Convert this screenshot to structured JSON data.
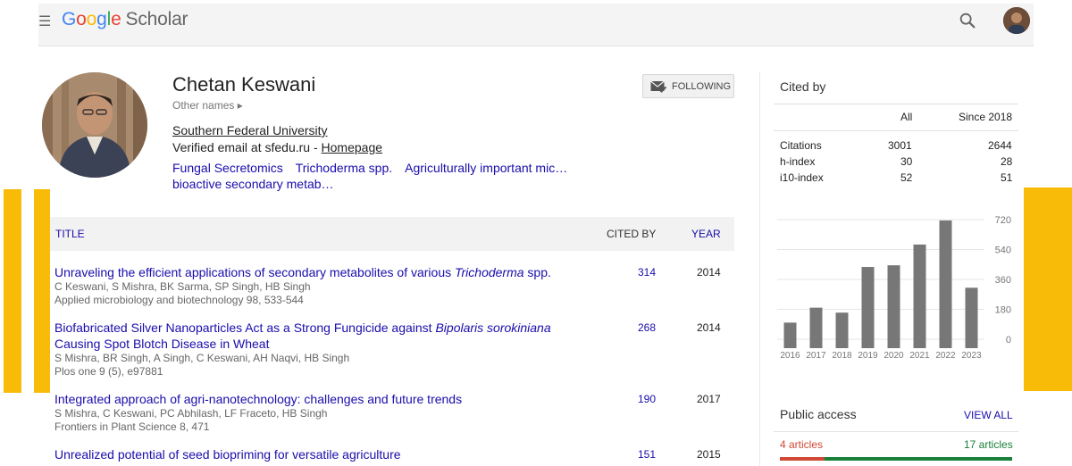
{
  "app": {
    "logo_google": [
      "G",
      "o",
      "o",
      "g",
      "l",
      "e"
    ],
    "logo_scholar": "Scholar"
  },
  "profile": {
    "name": "Chetan Keswani",
    "other_names": "Other names",
    "affiliation": "Southern Federal University",
    "email_prefix": "Verified email at sfedu.ru - ",
    "homepage": "Homepage",
    "interests": [
      "Fungal Secretomics",
      "Trichoderma spp.",
      "Agriculturally important mic…",
      "bioactive secondary metab…"
    ]
  },
  "follow": {
    "label": "FOLLOWING"
  },
  "table": {
    "col_title": "TITLE",
    "col_cited": "CITED BY",
    "col_year": "YEAR"
  },
  "articles": [
    {
      "title_a": "Unraveling the efficient applications of secondary metabolites of various ",
      "title_b": "Trichoderma",
      "title_c": " spp.",
      "authors": "C Keswani, S Mishra, BK Sarma, SP Singh, HB Singh",
      "venue": "Applied microbiology and biotechnology 98, 533-544",
      "cites": "314",
      "year": "2014"
    },
    {
      "title_a": "Biofabricated Silver Nanoparticles Act as a Strong Fungicide against ",
      "title_b": "Bipolaris sorokiniana",
      "title_c": " Causing Spot Blotch Disease in Wheat",
      "authors": "S Mishra, BR Singh, A Singh, C Keswani, AH Naqvi, HB Singh",
      "venue": "Plos one 9 (5), e97881",
      "cites": "268",
      "year": "2014"
    },
    {
      "title_a": "Integrated approach of agri-nanotechnology: challenges and future trends",
      "title_b": "",
      "title_c": "",
      "authors": "S Mishra, C Keswani, PC Abhilash, LF Fraceto, HB Singh",
      "venue": "Frontiers in Plant Science 8, 471",
      "cites": "190",
      "year": "2017"
    },
    {
      "title_a": "Unrealized potential of seed biopriming for versatile agriculture",
      "title_b": "",
      "title_c": "",
      "authors": "",
      "venue": "",
      "cites": "151",
      "year": "2015"
    }
  ],
  "cited_by": {
    "title": "Cited by",
    "col_all": "All",
    "col_since": "Since 2018",
    "rows": [
      {
        "label": "Citations",
        "all": "3001",
        "since": "2644"
      },
      {
        "label": "h-index",
        "all": "30",
        "since": "28"
      },
      {
        "label": "i10-index",
        "all": "52",
        "since": "51"
      }
    ]
  },
  "chart_data": {
    "type": "bar",
    "categories": [
      "2016",
      "2017",
      "2018",
      "2019",
      "2020",
      "2021",
      "2022",
      "2023"
    ],
    "values": [
      100,
      190,
      160,
      435,
      445,
      570,
      715,
      310
    ],
    "yticks": [
      0,
      180,
      360,
      540,
      720
    ],
    "ylim": [
      0,
      720
    ],
    "grid": true,
    "bar_color": "#777777"
  },
  "public_access": {
    "title": "Public access",
    "view_all": "VIEW ALL",
    "not_available": "4 articles",
    "available": "17 articles",
    "not_available_count": 4,
    "available_count": 17
  },
  "colors": {
    "accent_yellow": "#f7bb08",
    "link_blue": "#1a0dab",
    "red": "#d14836",
    "green": "#188038"
  }
}
